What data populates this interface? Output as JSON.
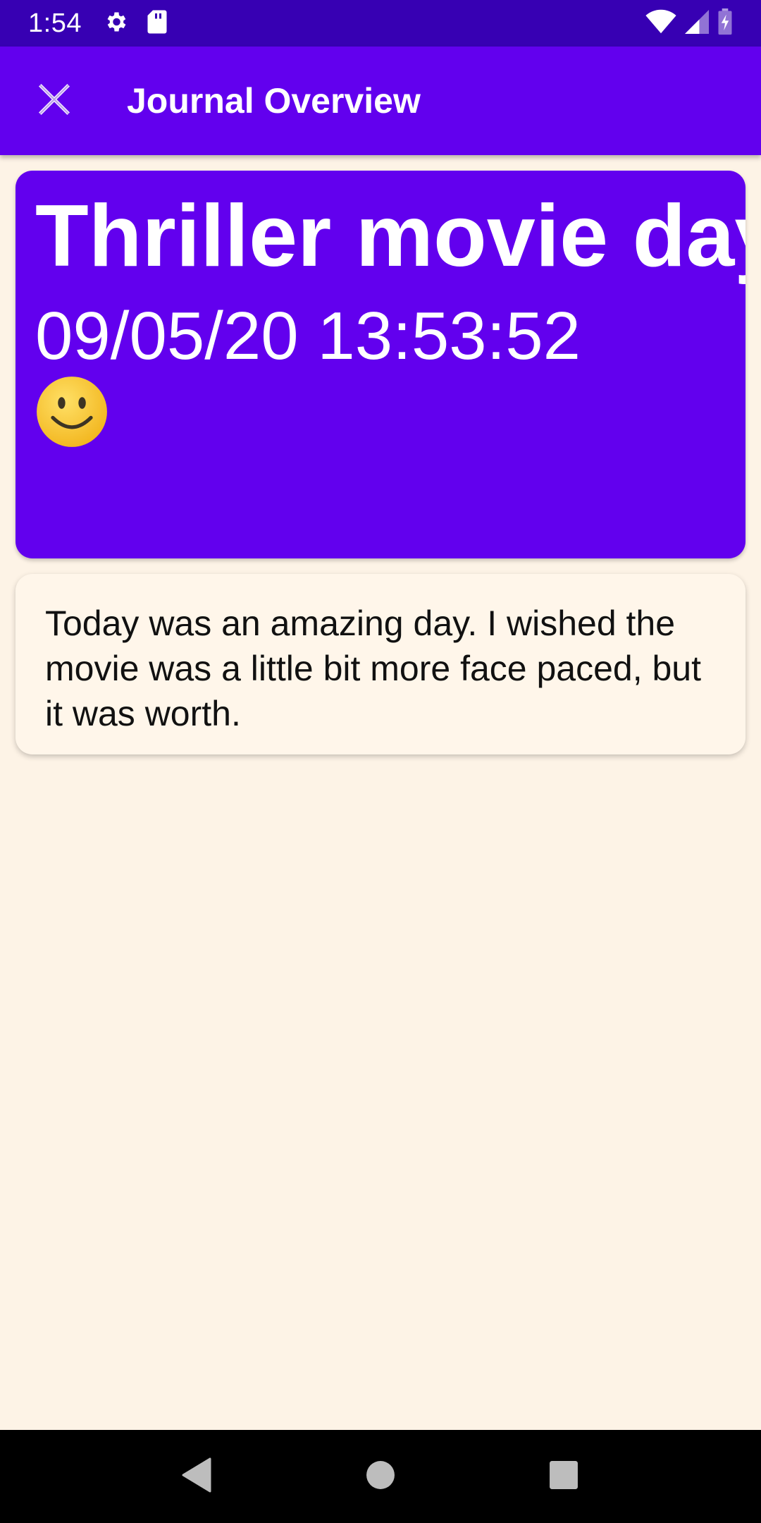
{
  "status_bar": {
    "time": "1:54",
    "icons": [
      "gear-icon",
      "sd-card-icon",
      "wifi-icon",
      "signal-icon",
      "battery-charging-icon"
    ]
  },
  "app_bar": {
    "title": "Journal Overview",
    "close_icon": "close-icon"
  },
  "entry": {
    "title": "Thriller movie day",
    "datetime": "09/05/20 13:53:52",
    "mood_icon": "smiley-face-icon",
    "body": "Today was an amazing day. I wished the movie was a little bit more face paced, but it was worth."
  },
  "nav_bar": {
    "icons": [
      "back-triangle-icon",
      "home-circle-icon",
      "recents-square-icon"
    ]
  },
  "colors": {
    "status_bar": "#3700b3",
    "primary": "#6200ee",
    "background": "#fdf3e6",
    "card": "#fff6ea",
    "smiley": "#f6c12c"
  }
}
